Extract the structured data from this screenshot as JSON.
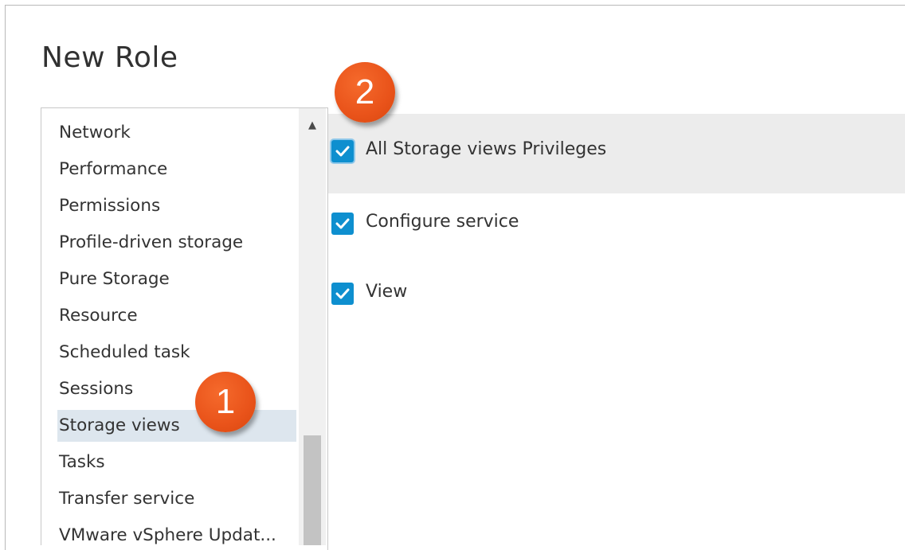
{
  "dialog": {
    "title": "New Role"
  },
  "categories": {
    "items": [
      {
        "label": "Network"
      },
      {
        "label": "Performance"
      },
      {
        "label": "Permissions"
      },
      {
        "label": "Profile-driven storage"
      },
      {
        "label": "Pure Storage"
      },
      {
        "label": "Resource"
      },
      {
        "label": "Scheduled task"
      },
      {
        "label": "Sessions"
      },
      {
        "label": "Storage views"
      },
      {
        "label": "Tasks"
      },
      {
        "label": "Transfer service"
      },
      {
        "label": "VMware vSphere Updat..."
      }
    ],
    "selected": "Storage views",
    "scroll_up_glyph": "▲"
  },
  "privileges": {
    "items": [
      {
        "label": "All Storage views Privileges",
        "checked": true
      },
      {
        "label": "Configure service",
        "checked": true
      },
      {
        "label": "View",
        "checked": true
      }
    ]
  },
  "callouts": [
    {
      "number": "1"
    },
    {
      "number": "2"
    }
  ],
  "colors": {
    "accent": "#0e8fcf",
    "selection": "#dde6ee",
    "callout": "#e9531a"
  }
}
